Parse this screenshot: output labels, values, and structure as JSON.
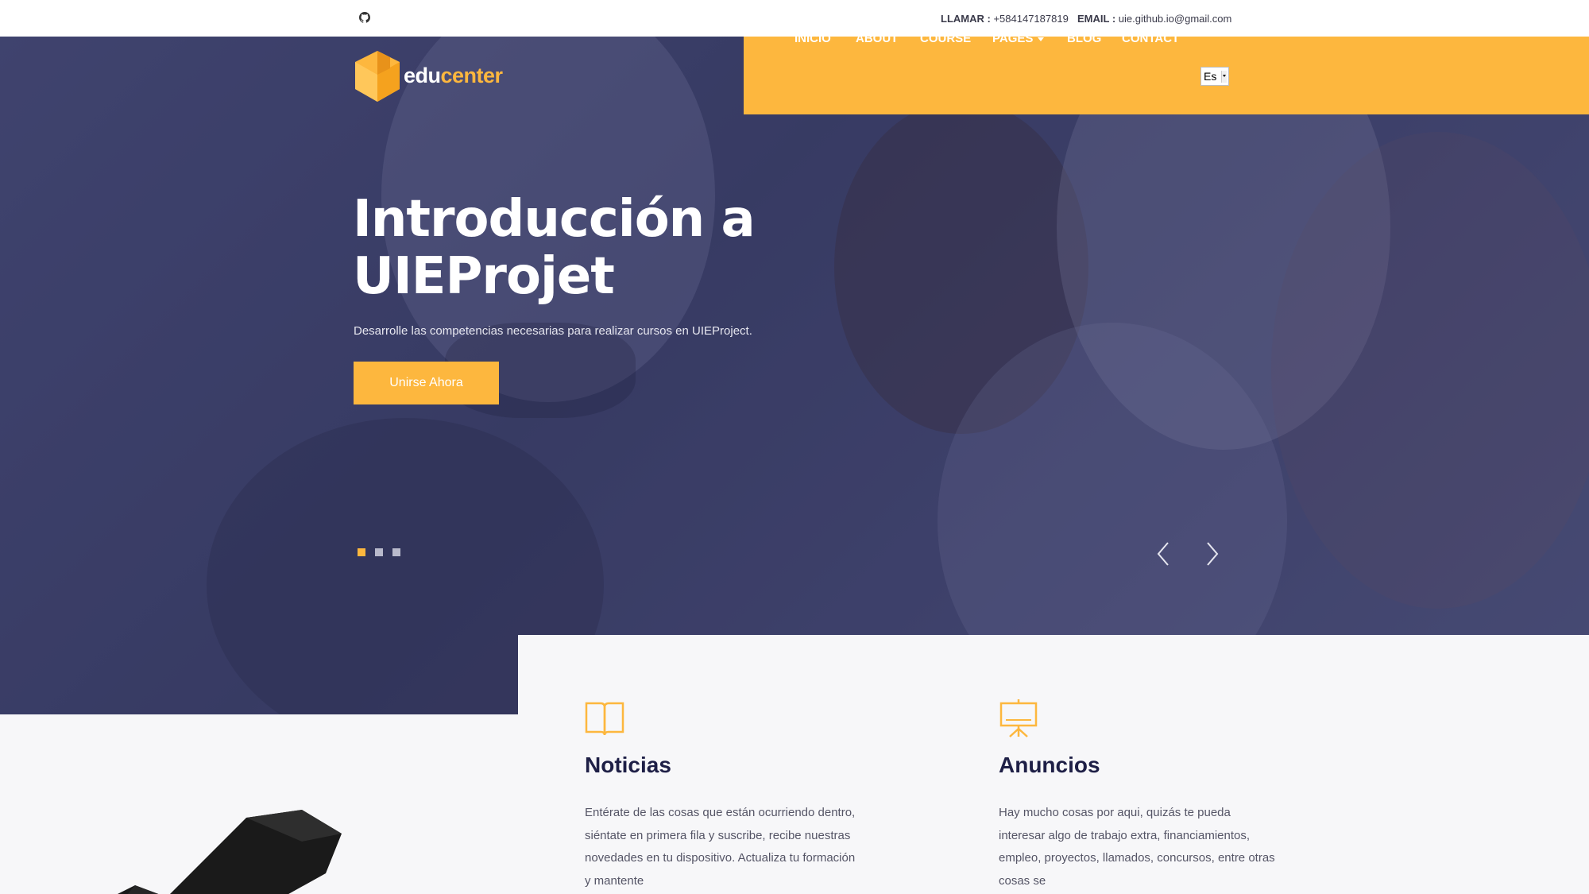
{
  "topbar": {
    "phone_label": "LLAMAR :",
    "phone_value": "+584147187819",
    "email_label": "EMAIL :",
    "email_value": "uie.github.io@gmail.com",
    "icon": "github-icon"
  },
  "brand": {
    "logo_part1": "edu",
    "logo_part2": "center",
    "accent_color": "#fdb73e",
    "dark_color": "#1e1f46"
  },
  "nav": {
    "items": [
      "INICIO",
      "ABOUT",
      "COURSE",
      "PAGES",
      "BLOG",
      "CONTACT"
    ],
    "language_selected": "Es"
  },
  "hero": {
    "title_line1": "Introducción a",
    "title_line2": "UIEProjet",
    "subtitle": "Desarrolle las competencias necesarias para realizar cursos en UIEProject.",
    "button_label": "Unirse Ahora",
    "slides_total": 3,
    "active_slide": 1
  },
  "features": [
    {
      "icon": "book-open-icon",
      "title": "Noticias",
      "text": "Entérate de las cosas que están ocurriendo dentro, siéntate en primera fila y suscribe, recibe nuestras novedades en tu dispositivo. Actualiza tu formación y mantente"
    },
    {
      "icon": "presentation-board-icon",
      "title": "Anuncios",
      "text": "Hay mucho cosas por aqui, quizás te pueda interesar algo de trabajo extra, financiamientos, empleo, proyectos, llamados, concursos, entre otras cosas se"
    }
  ]
}
